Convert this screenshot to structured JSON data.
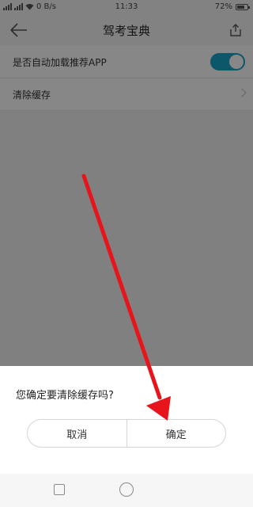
{
  "status_bar": {
    "speed": "0 B/s",
    "time": "11:33",
    "battery": "72%",
    "battery_level": 0.72
  },
  "header": {
    "title": "驾考宝典",
    "back_icon": "arrow-left-icon",
    "share_icon": "share-icon"
  },
  "settings": {
    "auto_load_label": "是否自动加载推荐APP",
    "auto_load_enabled": true,
    "clear_cache_label": "清除缓存"
  },
  "dialog": {
    "message": "您确定要清除缓存吗?",
    "cancel_label": "取消",
    "confirm_label": "确定"
  },
  "colors": {
    "accent": "#1aa4c8",
    "annotation_arrow": "#e8141b"
  }
}
